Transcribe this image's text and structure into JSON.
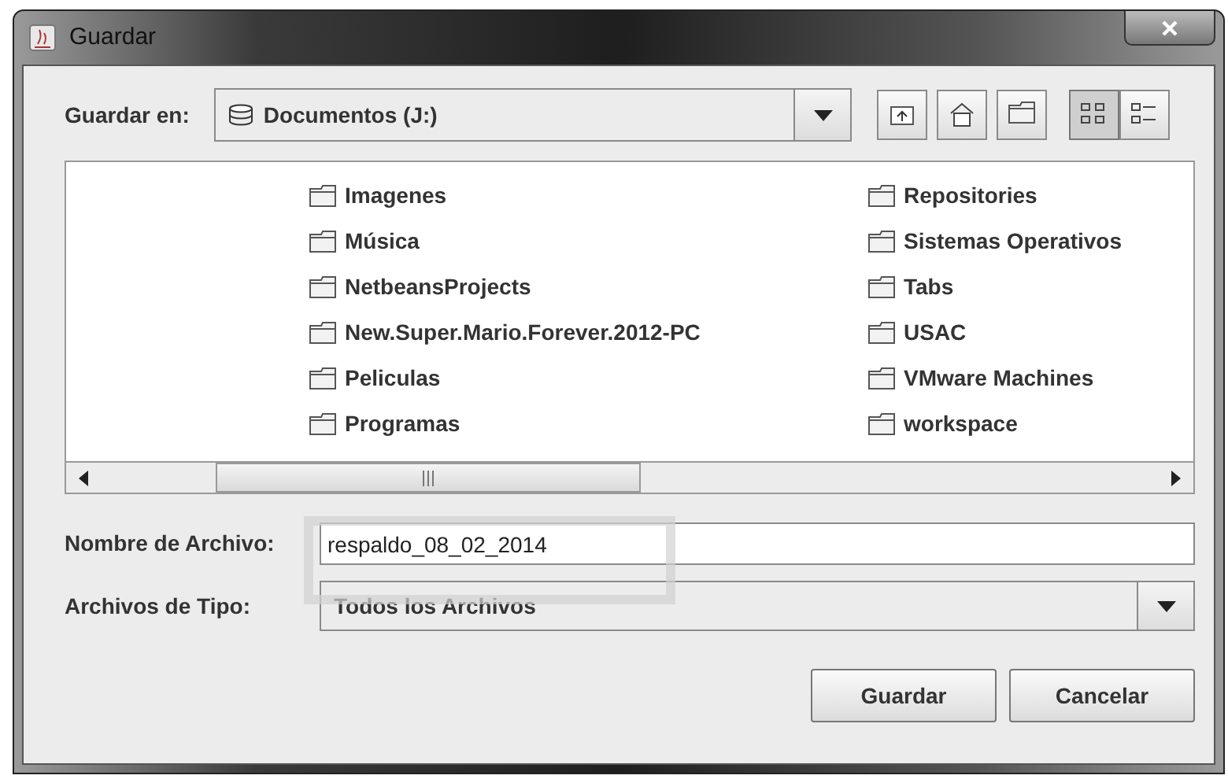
{
  "window": {
    "title": "Guardar"
  },
  "save_in": {
    "label": "Guardar en:",
    "value": "Documentos (J:)"
  },
  "toolbar": [
    {
      "kind": "up",
      "selected": false
    },
    {
      "kind": "home",
      "selected": false
    },
    {
      "kind": "new-folder",
      "selected": false
    },
    {
      "kind": "list",
      "selected": true
    },
    {
      "kind": "details",
      "selected": false
    }
  ],
  "file_list": {
    "columns": [
      {
        "items": [
          "Imagenes",
          "Música",
          "NetbeansProjects",
          "New.Super.Mario.Forever.2012-PC",
          "Peliculas",
          "Programas"
        ]
      },
      {
        "items": [
          "Repositories",
          "Sistemas Operativos",
          "Tabs",
          "USAC",
          "VMware Machines",
          "workspace"
        ]
      }
    ]
  },
  "file_name": {
    "label": "Nombre de Archivo:",
    "value": "respaldo_08_02_2014"
  },
  "file_type": {
    "label": "Archivos de Tipo:",
    "value": "Todos los Archivos"
  },
  "buttons": [
    "Guardar",
    "Cancelar"
  ]
}
